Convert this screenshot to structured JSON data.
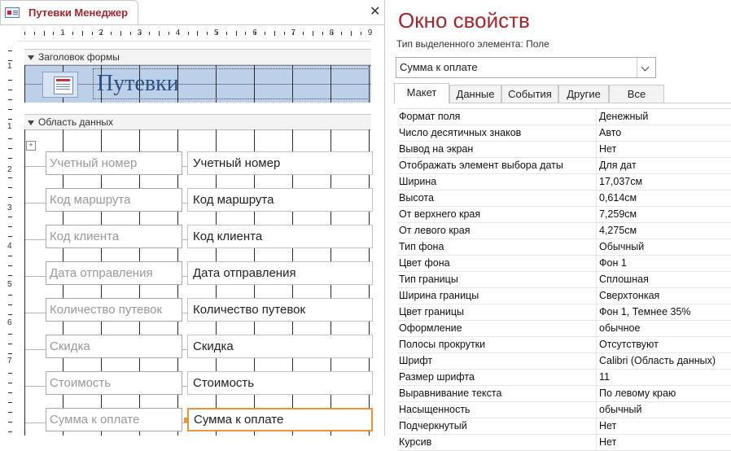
{
  "designer": {
    "tab_title": "Путевки Менеджер",
    "close_icon": "close-icon",
    "ruler_numbers": [
      "1",
      "2",
      "3",
      "4",
      "5",
      "6",
      "7",
      "8",
      "9"
    ],
    "vruler_numbers": [
      "1",
      "1",
      "2",
      "3",
      "4",
      "5",
      "6",
      "7"
    ],
    "header_band_label": "Заголовок формы",
    "form_title": "Путевки",
    "detail_band_label": "Область данных",
    "rows": [
      {
        "label": "Учетный номер",
        "field": "Учетный номер"
      },
      {
        "label": "Код маршрута",
        "field": "Код маршрута"
      },
      {
        "label": "Код клиента",
        "field": "Код клиента"
      },
      {
        "label": "Дата отправления",
        "field": "Дата отправления"
      },
      {
        "label": "Количество путевок",
        "field": "Количество путевок"
      },
      {
        "label": "Скидка",
        "field": "Скидка"
      },
      {
        "label": "Стоимость",
        "field": "Стоимость"
      },
      {
        "label": "Сумма к оплате",
        "field": "Сумма к оплате"
      }
    ],
    "selected_color": "#e8953a"
  },
  "properties": {
    "title": "Окно свойств",
    "selection_type": "Тип выделенного элемента:  Поле",
    "selected_item": "Сумма к оплате",
    "tabs": [
      "Макет",
      "Данные",
      "События",
      "Другие",
      "Все"
    ],
    "active_tab": "Макет",
    "rows": [
      {
        "name": "Формат поля",
        "value": "Денежный"
      },
      {
        "name": "Число десятичных знаков",
        "value": "Авто"
      },
      {
        "name": "Вывод на экран",
        "value": "Нет"
      },
      {
        "name": "Отображать элемент выбора даты",
        "value": "Для дат"
      },
      {
        "name": "Ширина",
        "value": "17,037см"
      },
      {
        "name": "Высота",
        "value": "0,614см"
      },
      {
        "name": "От верхнего края",
        "value": "7,259см"
      },
      {
        "name": "От левого края",
        "value": "4,275см"
      },
      {
        "name": "Тип фона",
        "value": "Обычный"
      },
      {
        "name": "Цвет фона",
        "value": "Фон 1"
      },
      {
        "name": "Тип границы",
        "value": "Сплошная"
      },
      {
        "name": "Ширина границы",
        "value": "Сверхтонкая"
      },
      {
        "name": "Цвет границы",
        "value": "Фон 1, Темнее 35%"
      },
      {
        "name": "Оформление",
        "value": "обычное"
      },
      {
        "name": "Полосы прокрутки",
        "value": "Отсутствуют"
      },
      {
        "name": "Шрифт",
        "value": "Calibri (Область данных)"
      },
      {
        "name": "Размер шрифта",
        "value": "11"
      },
      {
        "name": "Выравнивание текста",
        "value": "По левому краю"
      },
      {
        "name": "Насыщенность",
        "value": "обычный"
      },
      {
        "name": "Подчеркнутый",
        "value": "Нет"
      },
      {
        "name": "Курсив",
        "value": "Нет"
      }
    ],
    "accent_color": "#a4262c"
  }
}
